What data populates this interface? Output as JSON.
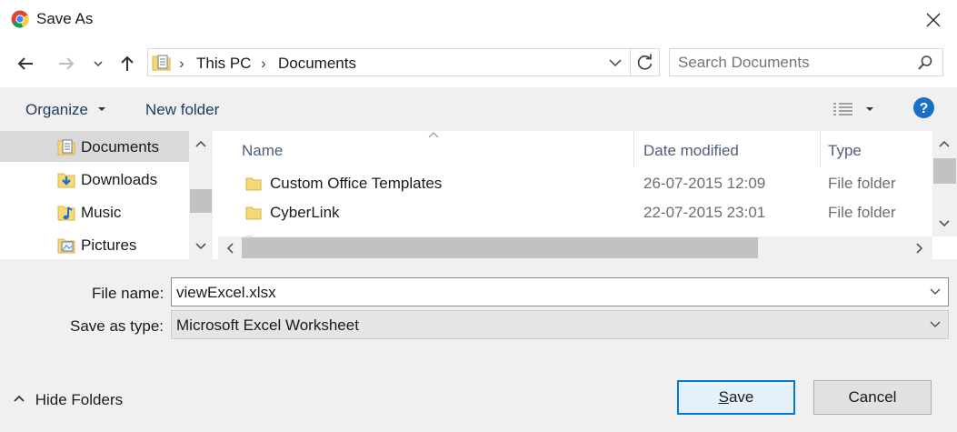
{
  "window": {
    "title": "Save As",
    "accent": "#0078d7"
  },
  "address": {
    "segments": [
      "This PC",
      "Documents"
    ]
  },
  "search": {
    "placeholder": "Search Documents"
  },
  "commands": {
    "organize": "Organize",
    "new_folder": "New folder"
  },
  "nav": {
    "items": [
      {
        "label": "Documents",
        "icon": "documents-folder-icon",
        "selected": true
      },
      {
        "label": "Downloads",
        "icon": "downloads-folder-icon"
      },
      {
        "label": "Music",
        "icon": "music-folder-icon"
      },
      {
        "label": "Pictures",
        "icon": "pictures-folder-icon"
      }
    ]
  },
  "list": {
    "columns": [
      "Name",
      "Date modified",
      "Type"
    ],
    "rows": [
      {
        "name": "Custom Office Templates",
        "date": "26-07-2015 12:09",
        "type": "File folder"
      },
      {
        "name": "CyberLink",
        "date": "22-07-2015 23:01",
        "type": "File folder"
      }
    ]
  },
  "form": {
    "file_name_label": "File name:",
    "file_name_value": "viewExcel.xlsx",
    "save_type_label": "Save as type:",
    "save_type_value": "Microsoft Excel Worksheet"
  },
  "footer": {
    "hide_folders": "Hide Folders",
    "save": "Save",
    "cancel": "Cancel"
  }
}
